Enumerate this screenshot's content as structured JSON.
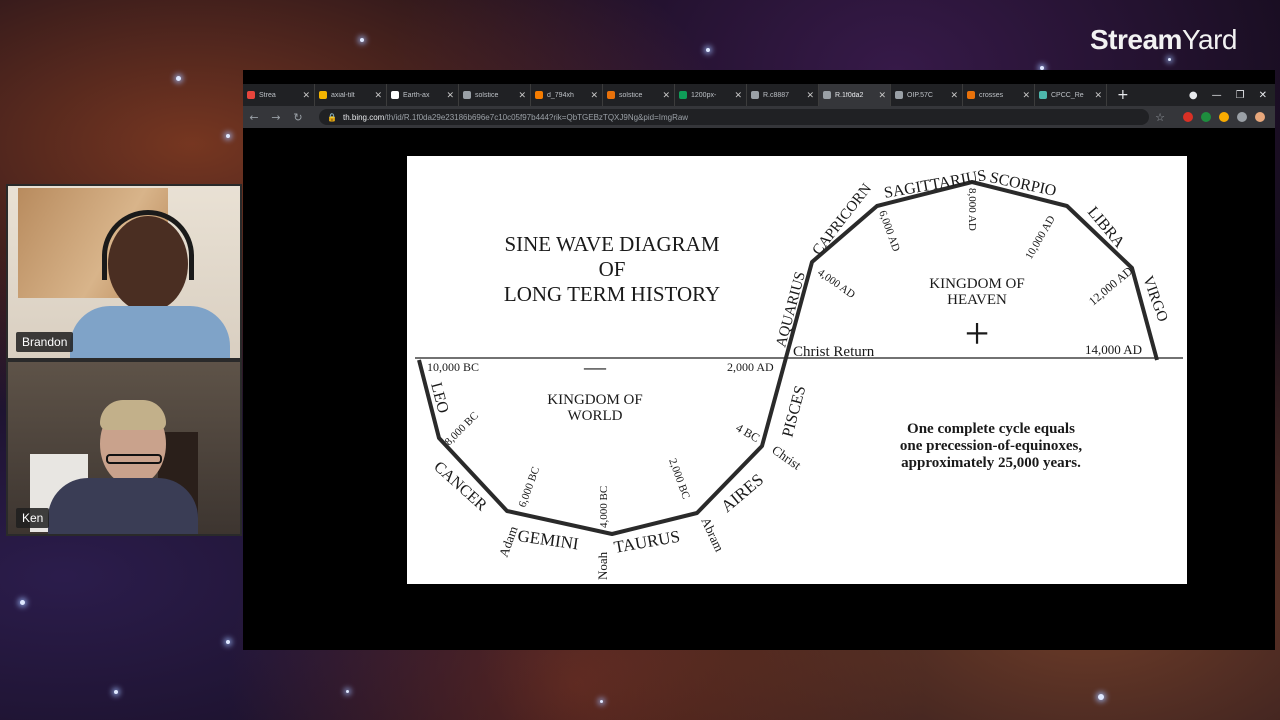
{
  "brand": {
    "bold": "Stream",
    "light": "Yard"
  },
  "participants": [
    {
      "name": "Brandon"
    },
    {
      "name": "Ken"
    }
  ],
  "browser": {
    "tabs": [
      {
        "label": "Strea",
        "color": "#e8453c"
      },
      {
        "label": "axial-tilt",
        "color": "#f4b400"
      },
      {
        "label": "Earth-ax",
        "color": "#ffffff"
      },
      {
        "label": "solstice",
        "color": "#9aa0a6"
      },
      {
        "label": "d_794xh",
        "color": "#f57c00"
      },
      {
        "label": "solstice",
        "color": "#e8710a"
      },
      {
        "label": "1200px-",
        "color": "#0f9d58"
      },
      {
        "label": "R.c8887",
        "color": "#9aa0a6"
      },
      {
        "label": "R.1f0da2",
        "color": "#9aa0a6"
      },
      {
        "label": "OIP.57C",
        "color": "#9aa0a6"
      },
      {
        "label": "crosses",
        "color": "#e8710a"
      },
      {
        "label": "CPCC_Re",
        "color": "#4db6ac"
      }
    ],
    "active_tab_index": 8,
    "url_host": "th.bing.com",
    "url_path": "/th/id/R.1f0da29e23186b696e7c10c05f97b444?rik=QbTGEBzTQXJ9Ng&pid=ImgRaw"
  },
  "diagram": {
    "title_lines": [
      "SINE WAVE DIAGRAM",
      "OF",
      "LONG TERM HISTORY"
    ],
    "kingdom_heaven": [
      "KINGDOM OF",
      "HEAVEN"
    ],
    "kingdom_world": [
      "KINGDOM OF",
      "WORLD"
    ],
    "plus_sign": "+",
    "minus_sign": "—",
    "christ_return": "Christ Return",
    "cycle_text": [
      "One complete cycle equals",
      "one precession-of-equinoxes,",
      "approximately 25,000 years."
    ],
    "signs": {
      "leo": "LEO",
      "cancer": "CANCER",
      "gemini": "GEMINI",
      "taurus": "TAURUS",
      "aires": "AIRES",
      "pisces": "PISCES",
      "aquarius": "AQUARIUS",
      "capricorn": "CAPRICORN",
      "sagittarius": "SAGITTARIUS",
      "scorpio": "SCORPIO",
      "libra": "LIBRA",
      "virgo": "VIRGO"
    },
    "dates": {
      "bc10000": "10,000 BC",
      "bc8000": "8,000 BC",
      "bc6000": "6,000 BC",
      "bc4000": "4,000 BC",
      "bc2000": "2,000 BC",
      "bc4": "4 BC",
      "ad2000": "2,000 AD",
      "ad4000": "4,000 AD",
      "ad6000": "6,000 AD",
      "ad8000": "8,000 AD",
      "ad10000": "10,000 AD",
      "ad12000": "12,000 AD",
      "ad14000": "14,000 AD"
    },
    "people": {
      "adam": "Adam",
      "noah": "Noah",
      "abram": "Abram",
      "christ": "Christ"
    }
  }
}
